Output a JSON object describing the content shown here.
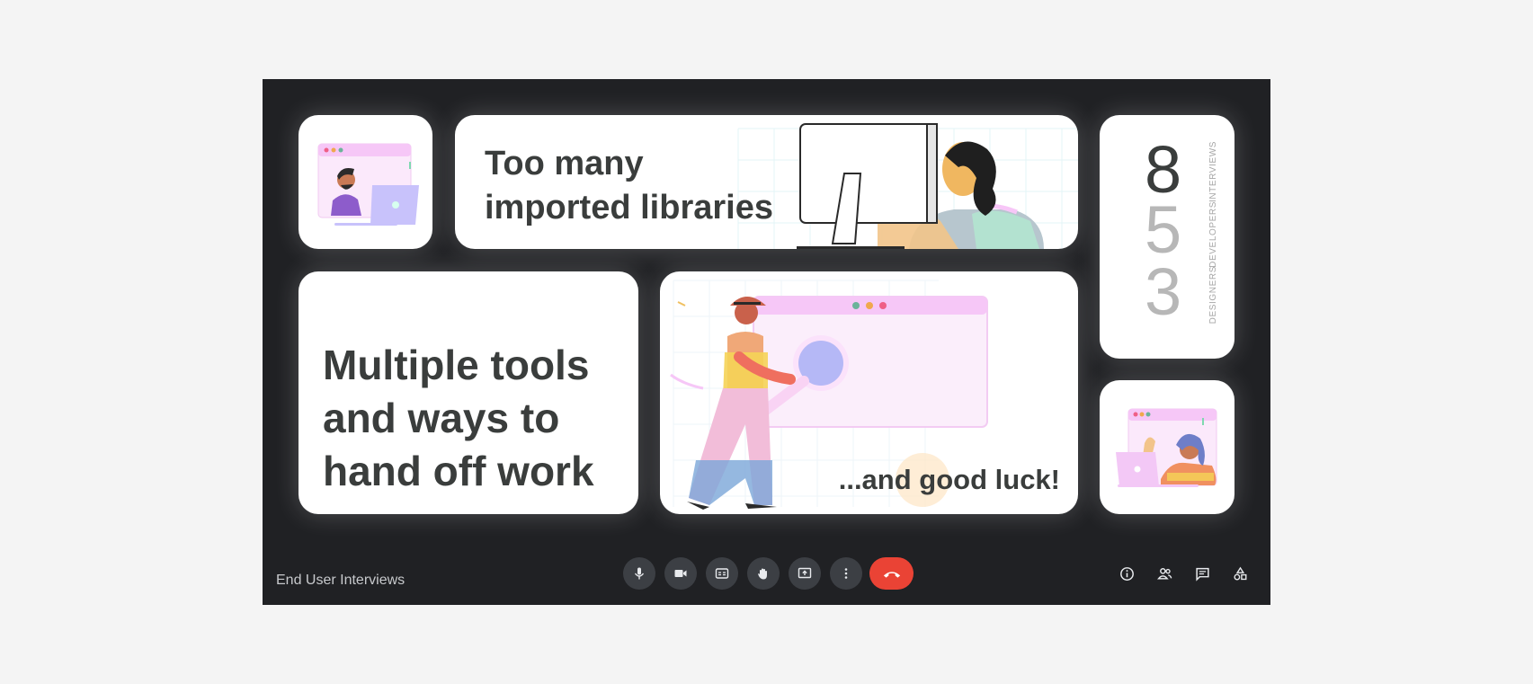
{
  "meeting": {
    "title": "End User Interviews"
  },
  "slides": {
    "banner_text": "Too many\nimported libraries",
    "multi_text": "Multiple tools\nand ways to\nhand off work",
    "luck_text": "...and good luck!"
  },
  "stats": [
    {
      "value": "8",
      "label": "INTERVIEWS",
      "color": "#3a3d3c"
    },
    {
      "value": "5",
      "label": "DEVELOPERS",
      "color": "#b7b7b7"
    },
    {
      "value": "3",
      "label": "DESIGNERS",
      "color": "#b7b7b7"
    }
  ],
  "controls": [
    {
      "name": "microphone-button",
      "icon": "microphone-icon"
    },
    {
      "name": "camera-button",
      "icon": "video-camera-icon"
    },
    {
      "name": "captions-button",
      "icon": "closed-captions-icon"
    },
    {
      "name": "raise-hand-button",
      "icon": "hand-icon"
    },
    {
      "name": "present-button",
      "icon": "present-screen-icon"
    },
    {
      "name": "more-options-button",
      "icon": "more-vertical-icon"
    },
    {
      "name": "end-call-button",
      "icon": "phone-hangup-icon"
    }
  ],
  "side_controls": [
    {
      "name": "meeting-info-button",
      "icon": "info-icon"
    },
    {
      "name": "participants-button",
      "icon": "people-icon"
    },
    {
      "name": "chat-button",
      "icon": "chat-icon"
    },
    {
      "name": "activities-button",
      "icon": "shapes-icon"
    }
  ],
  "colors": {
    "frame": "#202124",
    "tile": "#ffffff",
    "hangup": "#ea4335",
    "heading": "#3a3d3c",
    "muted": "#b7b7b7"
  }
}
